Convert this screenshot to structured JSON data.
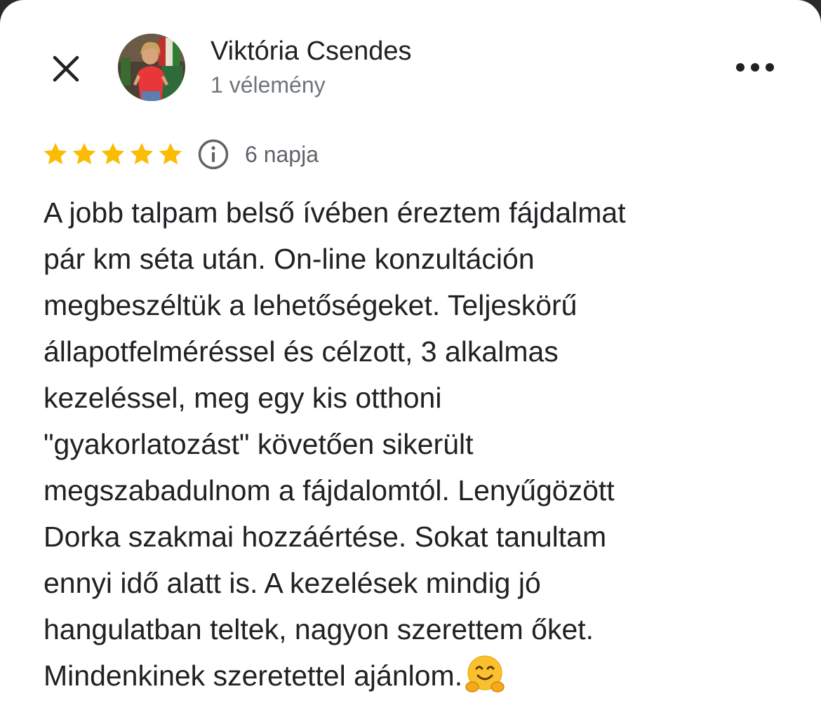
{
  "author": {
    "name": "Viktória Csendes",
    "review_count": "1 vélemény"
  },
  "rating": {
    "stars": 5,
    "max": 5,
    "color": "#fbbc04"
  },
  "date": "6 napja",
  "icons": {
    "close": "close-icon",
    "more": "more-icon",
    "info": "info-icon",
    "emoji": "hugging-face-emoji"
  },
  "review": {
    "lines": [
      "A jobb talpam belső ívében éreztem fájdalmat",
      "pár km séta után. On-line konzultáción",
      "megbeszéltük a lehetőségeket. Teljeskörű",
      "állapotfelméréssel és célzott, 3 alkalmas",
      "kezeléssel, meg egy kis otthoni",
      "\"gyakorlatozást\" követően sikerült",
      "megszabadulnom a fájdalomtól. Lenyűgözött",
      "Dorka szakmai hozzáértése. Sokat tanultam",
      "ennyi idő alatt is. A kezelések mindig jó",
      "hangulatban teltek, nagyon szerettem őket.",
      "Mindenkinek szeretettel ajánlom."
    ]
  }
}
